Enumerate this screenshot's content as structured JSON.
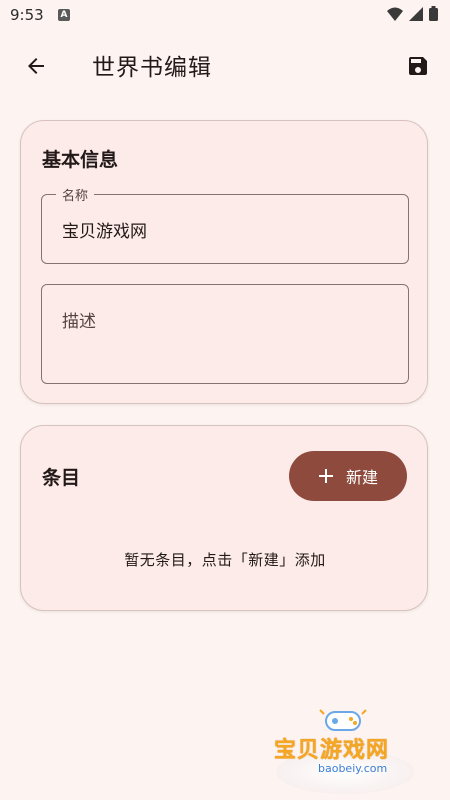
{
  "status": {
    "time": "9:53",
    "notif_letter": "A"
  },
  "header": {
    "title": "世界书编辑"
  },
  "basic_info": {
    "title": "基本信息",
    "name_field": {
      "label": "名称",
      "value": "宝贝游戏网"
    },
    "description_field": {
      "placeholder": "描述"
    }
  },
  "entries": {
    "title": "条目",
    "new_button_label": "新建",
    "empty_message": "暂无条目，点击「新建」添加"
  },
  "watermark": {
    "text": "宝贝游戏网",
    "url": "baobeiy.com"
  },
  "colors": {
    "accent": "#8e4b3d",
    "background": "#fdf3f1",
    "card": "#fcebe8"
  }
}
